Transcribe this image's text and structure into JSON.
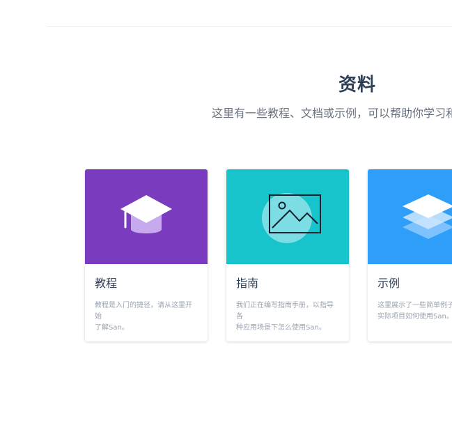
{
  "section": {
    "title": "资料",
    "subtitle": "这里有一些教程、文档或示例，可以帮助你学习和"
  },
  "cards": [
    {
      "title": "教程",
      "description": "教程是入门的捷径，请从这里开始\n了解San。",
      "icon": "graduation-cap-icon",
      "color": "#7a3bbe"
    },
    {
      "title": "指南",
      "description": "我们正在编写指南手册，以指导各\n种应用场景下怎么使用San。",
      "icon": "image-icon",
      "color": "#17c4cc"
    },
    {
      "title": "示例",
      "description": "这里展示了一些简单例子，\n实际项目如何使用San。",
      "icon": "layers-icon",
      "color": "#2e9ef8"
    }
  ]
}
